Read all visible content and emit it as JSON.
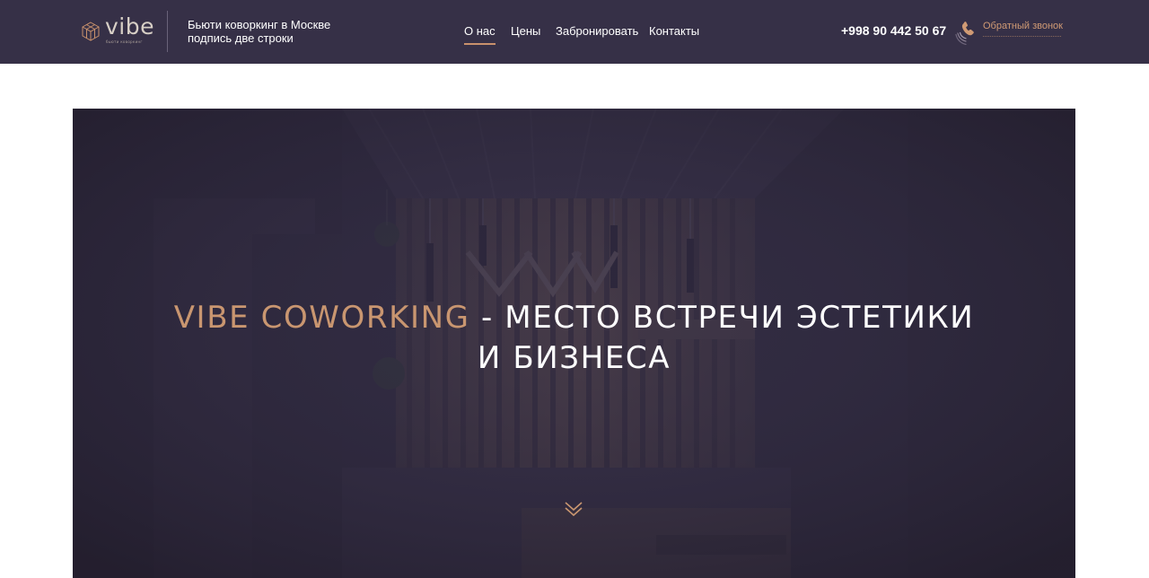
{
  "colors": {
    "header_bg": "#363047",
    "accent": "#c99670",
    "hero_overlay": "#322b43",
    "text": "#ffffff"
  },
  "header": {
    "logo": {
      "word": "vibe",
      "subtitle": "бьюти коворкинг",
      "icon": "hexagon-cube-icon"
    },
    "tagline": {
      "line1": "Бьюти коворкинг в Москве",
      "line2": "подпись две строки"
    },
    "nav": [
      {
        "label": "О нас",
        "active": true
      },
      {
        "label": "Цены",
        "active": false
      },
      {
        "label": "Забронировать",
        "active": false
      },
      {
        "label": "Контакты",
        "active": false
      }
    ],
    "phone": "+998 90 442 50 67",
    "callback": {
      "label": "Обратный звонок",
      "icon": "phone-ringing-icon"
    }
  },
  "hero": {
    "title_accent": "VIBE COWORKING",
    "title_rest": " - МЕСТО ВСТРЕЧИ ЭСТЕТИКИ",
    "title_line2": "И БИЗНЕСА",
    "scroll_icon": "double-chevron-down-icon"
  }
}
